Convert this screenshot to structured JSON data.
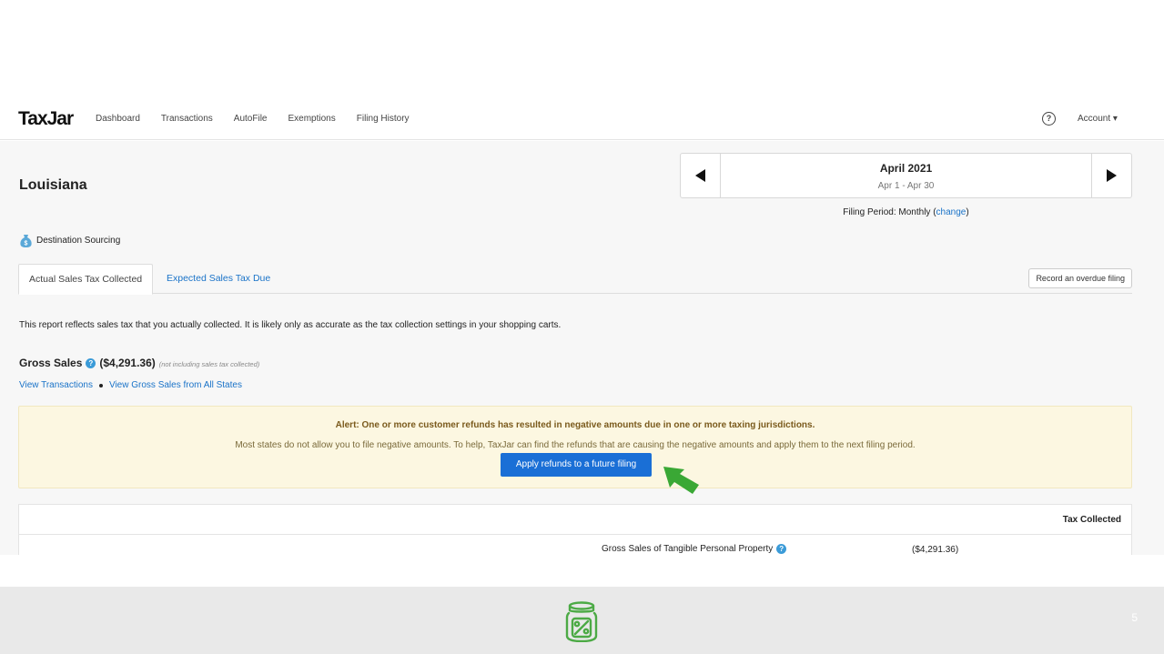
{
  "nav": {
    "logo": "TaxJar",
    "links": [
      "Dashboard",
      "Transactions",
      "AutoFile",
      "Exemptions",
      "Filing History"
    ],
    "help_glyph": "?",
    "account": "Account ▾"
  },
  "page": {
    "state": "Louisiana",
    "period_month": "April 2021",
    "period_range": "Apr 1 - Apr 30",
    "filing_period_prefix": "Filing Period: Monthly (",
    "filing_period_link": "change",
    "filing_period_suffix": ")",
    "sourcing": "Destination Sourcing",
    "tabs": [
      "Actual Sales Tax Collected",
      "Expected Sales Tax Due"
    ],
    "overdue_button": "Record an overdue filing",
    "report_text": "This report reflects sales tax that you actually collected. It is likely only as accurate as the tax collection settings in your shopping carts.",
    "gross_label": "Gross Sales",
    "gross_amount": "($4,291.36)",
    "gross_note": "(not including sales tax collected)",
    "view_transactions": "View Transactions",
    "view_gross_all": "View Gross Sales from All States"
  },
  "alert": {
    "title": "Alert: One or more customer refunds has resulted in negative amounts due in one or more taxing jurisdictions.",
    "body": "Most states do not allow you to file negative amounts. To help, TaxJar can find the refunds that are causing the negative amounts and apply them to the next filing period.",
    "button": "Apply refunds to a future filing"
  },
  "table": {
    "header": "Tax Collected",
    "row_label": "Gross Sales of Tangible Personal Property",
    "row_value": "($4,291.36)"
  },
  "footer": {
    "page_number": "5"
  },
  "colors": {
    "accent": "#1a6fd6",
    "link": "#1a73c8",
    "alert_bg": "#fcf7e1",
    "arrow": "#3aa835"
  }
}
